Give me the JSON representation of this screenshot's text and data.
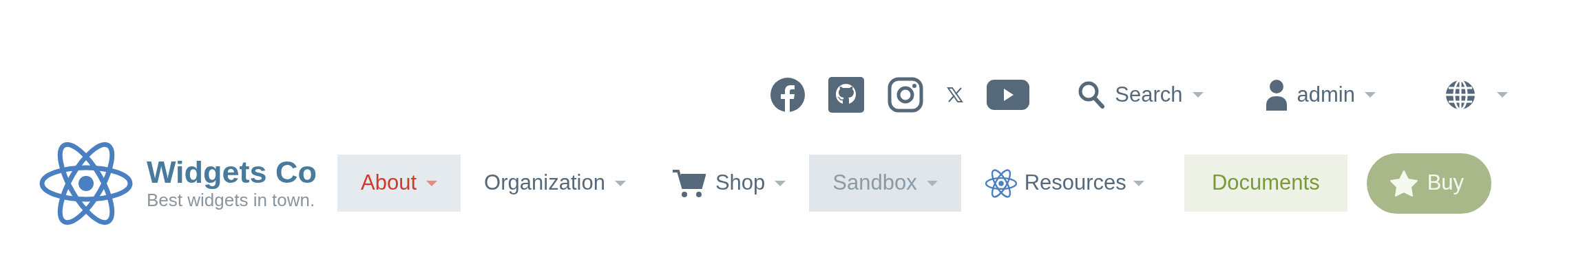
{
  "utility_bar": {
    "search": {
      "label": "Search",
      "has_dropdown": true
    },
    "user": {
      "label": "admin",
      "has_dropdown": true
    },
    "language": {
      "has_dropdown": true
    }
  },
  "brand": {
    "name": "Widgets Co",
    "tagline": "Best widgets in town."
  },
  "nav": [
    {
      "kind": "dropdown",
      "label": "About",
      "selected": true,
      "disabled": false
    },
    {
      "kind": "dropdown",
      "label": "Organization",
      "selected": false,
      "disabled": false
    },
    {
      "kind": "dropdown",
      "label": "Shop",
      "selected": false,
      "disabled": false
    },
    {
      "kind": "dropdown",
      "label": "Sandbox",
      "selected": false,
      "disabled": true
    },
    {
      "kind": "dropdown",
      "label": "Resources",
      "selected": false,
      "disabled": false
    },
    {
      "kind": "highlight",
      "label": "Documents"
    },
    {
      "kind": "button",
      "label": "Buy"
    }
  ]
}
